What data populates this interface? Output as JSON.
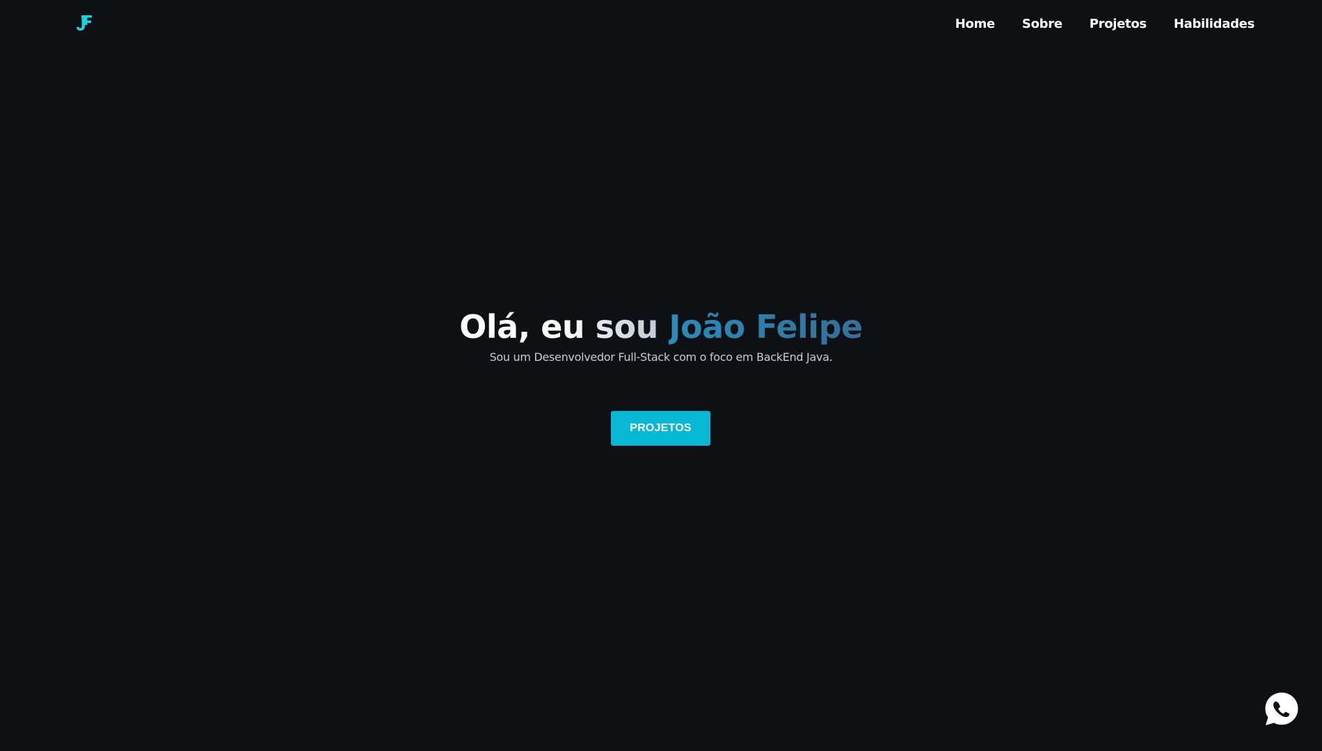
{
  "header": {
    "logo_text": "JF",
    "nav": [
      {
        "label": "Home"
      },
      {
        "label": "Sobre"
      },
      {
        "label": "Projetos"
      },
      {
        "label": "Habilidades"
      }
    ]
  },
  "hero": {
    "greeting": "Olá, eu sou ",
    "name": "João Felipe",
    "subtitle": "Sou um Desenvolvedor Full-Stack com o foco em BackEnd Java.",
    "button_label": "PROJETOS"
  },
  "floating": {
    "whatsapp_icon": "whatsapp-icon"
  },
  "colors": {
    "background": "#0f1013",
    "accent": "#08b7d4",
    "name_color": "#2e86b4",
    "logo": "#18d3dc"
  }
}
